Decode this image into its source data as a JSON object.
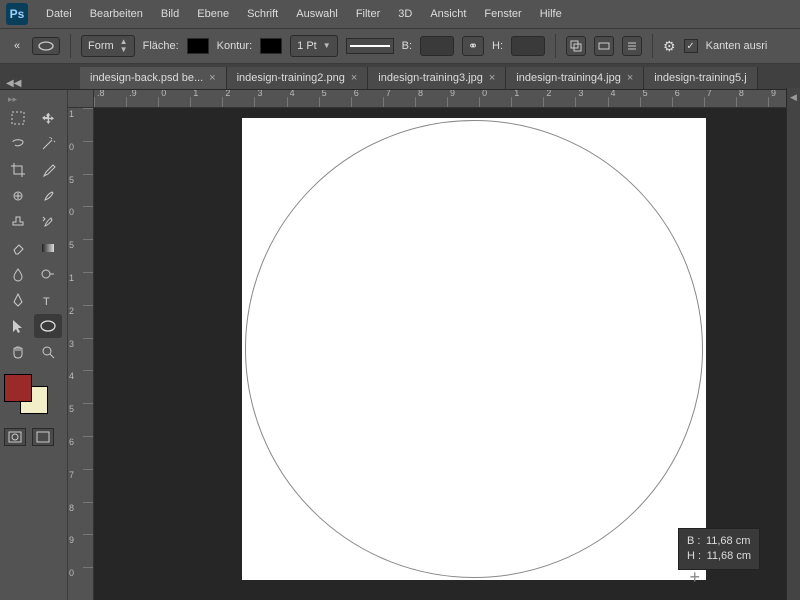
{
  "app": {
    "logo": "Ps"
  },
  "menu": [
    "Datei",
    "Bearbeiten",
    "Bild",
    "Ebene",
    "Schrift",
    "Auswahl",
    "Filter",
    "3D",
    "Ansicht",
    "Fenster",
    "Hilfe"
  ],
  "options": {
    "mode_label": "Form",
    "fill_label": "Fläche:",
    "stroke_label": "Kontur:",
    "stroke_width": "1 Pt",
    "w_label": "B:",
    "h_label": "H:",
    "antialias_label": "Kanten ausri"
  },
  "tabs": [
    {
      "label": "indesign-back.psd be...",
      "active": true
    },
    {
      "label": "indesign-training2.png",
      "active": false
    },
    {
      "label": "indesign-training3.jpg",
      "active": false
    },
    {
      "label": "indesign-training4.jpg",
      "active": false
    },
    {
      "label": "indesign-training5.j",
      "active": false
    }
  ],
  "ruler_h": [
    ".8",
    ".9",
    "0",
    "1",
    "2",
    "3",
    "4",
    "5",
    "6",
    "7",
    "8",
    "9",
    "0",
    "1",
    "2",
    "3",
    "4",
    "5",
    "6",
    "7",
    "8",
    "9"
  ],
  "ruler_v": [
    "1",
    "0",
    "5",
    "0",
    "5",
    "1",
    "2",
    "3",
    "4",
    "5",
    "6",
    "7",
    "8",
    "9",
    "0"
  ],
  "colors": {
    "fg": "#9a2a2a",
    "bg": "#f2eec8"
  },
  "tooltip": {
    "b_label": "B :",
    "b_value": "11,68 cm",
    "h_label": "H :",
    "h_value": "11,68 cm"
  }
}
